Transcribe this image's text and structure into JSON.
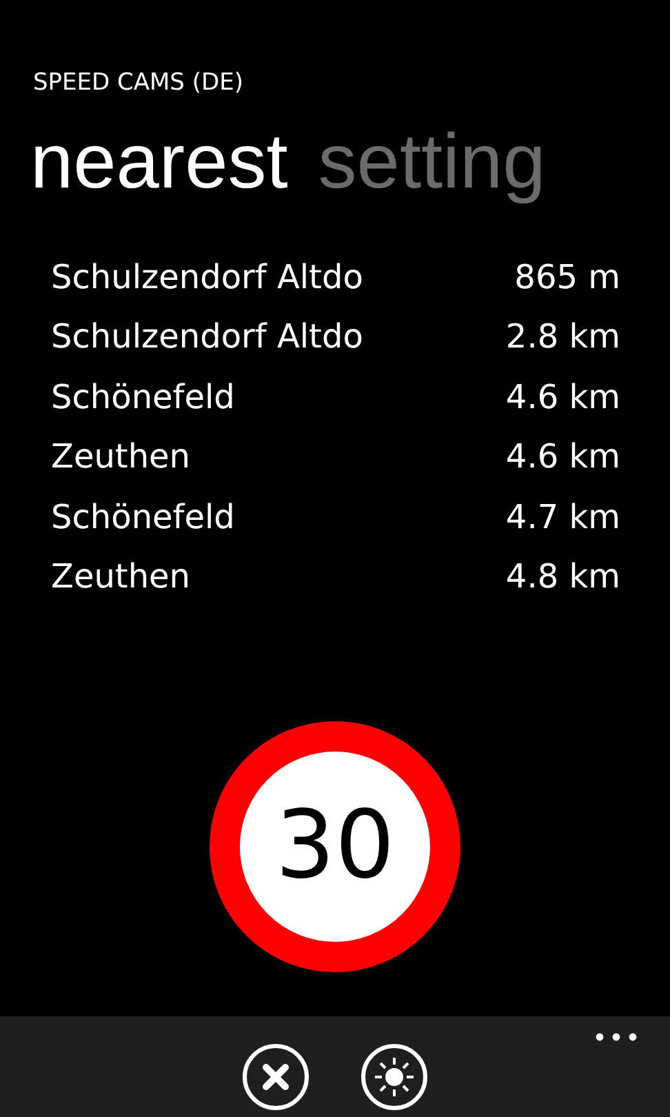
{
  "app_title": "SPEED CAMS (DE)",
  "pivot": [
    {
      "label": "nearest",
      "selected": true
    },
    {
      "label": "setting",
      "selected": false
    }
  ],
  "cameras": [
    {
      "name": "Schulzendorf Altdo",
      "distance": "865 m"
    },
    {
      "name": "Schulzendorf Altdo",
      "distance": "2.8 km"
    },
    {
      "name": "Schönefeld",
      "distance": "4.6 km"
    },
    {
      "name": "Zeuthen",
      "distance": "4.6 km"
    },
    {
      "name": "Schönefeld",
      "distance": "4.7 km"
    },
    {
      "name": "Zeuthen",
      "distance": "4.8 km"
    }
  ],
  "speed_limit": "30",
  "app_bar": {
    "buttons": [
      {
        "kind": "cancel"
      },
      {
        "kind": "brightness"
      }
    ]
  }
}
